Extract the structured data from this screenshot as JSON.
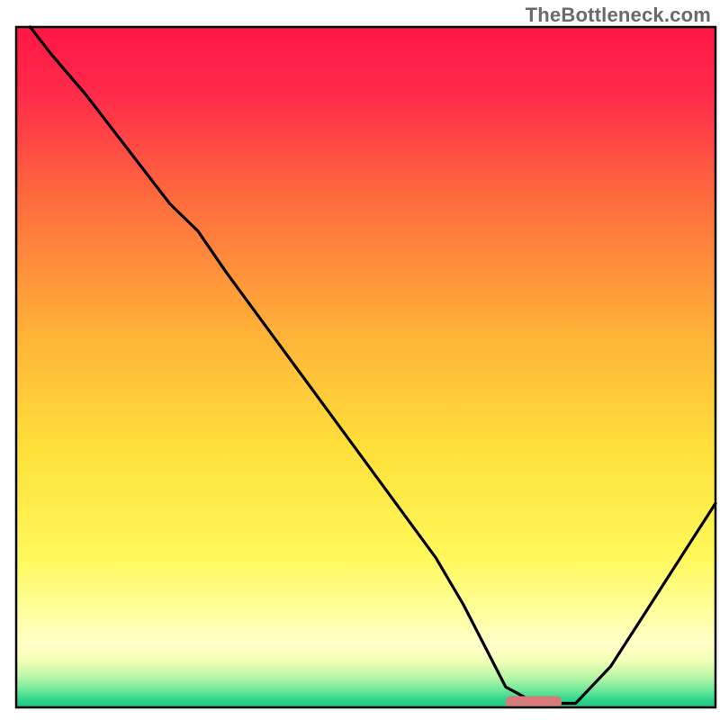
{
  "watermark": "TheBottleneck.com",
  "chart_data": {
    "type": "line",
    "title": "",
    "xlabel": "",
    "ylabel": "",
    "xlim": [
      0,
      100
    ],
    "ylim": [
      0,
      100
    ],
    "grid": false,
    "legend": false,
    "gradient_stops": [
      {
        "offset": 0.0,
        "color": "#ff1744"
      },
      {
        "offset": 0.1,
        "color": "#ff2b4a"
      },
      {
        "offset": 0.25,
        "color": "#ff6a3e"
      },
      {
        "offset": 0.45,
        "color": "#ffb238"
      },
      {
        "offset": 0.62,
        "color": "#ffe03a"
      },
      {
        "offset": 0.78,
        "color": "#fff85a"
      },
      {
        "offset": 0.86,
        "color": "#ffff9e"
      },
      {
        "offset": 0.905,
        "color": "#ffffc8"
      },
      {
        "offset": 0.93,
        "color": "#f4ffb8"
      },
      {
        "offset": 0.955,
        "color": "#baf7a8"
      },
      {
        "offset": 0.975,
        "color": "#6be89a"
      },
      {
        "offset": 0.99,
        "color": "#2bd28a"
      },
      {
        "offset": 1.0,
        "color": "#1cc67f"
      }
    ],
    "series": [
      {
        "name": "bottleneck-curve",
        "x": [
          2,
          5,
          10,
          16,
          22,
          26,
          30,
          35,
          40,
          45,
          50,
          55,
          60,
          64,
          68,
          70,
          74,
          76,
          80,
          85,
          90,
          95,
          100
        ],
        "y": [
          100,
          96,
          90,
          82,
          74,
          70,
          64,
          57,
          50,
          43,
          36,
          29,
          22,
          15,
          7,
          3,
          0.8,
          0.6,
          0.6,
          6,
          14,
          22,
          30
        ]
      }
    ],
    "marker": {
      "name": "optimal-range",
      "x_start": 70,
      "x_end": 78,
      "y": 0.8,
      "color": "#d97a7a"
    },
    "note": "x/y are percentage of plot area (0 = left/bottom, 100 = right/top). Values estimated from unlabeled axes."
  }
}
